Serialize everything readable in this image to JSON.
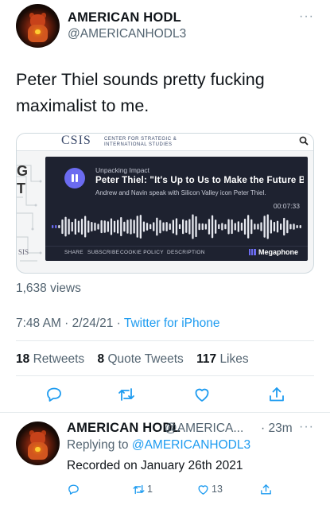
{
  "tweet": {
    "author_name": "AMERICAN HODL",
    "author_handle": "@AMERICANHODL3",
    "more_label": "···",
    "text": "Peter Thiel sounds pretty fucking maximalist to me.",
    "card": {
      "site_logo": "CSIS",
      "site_subtitle_1": "CENTER FOR STRATEGIC &",
      "site_subtitle_2": "INTERNATIONAL STUDIES",
      "side_letters": "G\nT",
      "side_footer": "SIS",
      "player": {
        "show": "Unpacking Impact",
        "title": "Peter Thiel: \"It's Up to Us to Make the Future B...",
        "description": "Andrew and Navin speak with Silicon Valley icon Peter Thiel.",
        "time": "00:07:33",
        "footer_links": [
          "SHARE",
          "SUBSCRIBE",
          "COOKIE POLICY",
          "DESCRIPTION"
        ],
        "brand": "Megaphone",
        "accent_color": "#6b6bf0"
      }
    },
    "views": "1,638 views",
    "time": "7:48 AM",
    "date": "2/24/21",
    "dot": " · ",
    "app": "Twitter for iPhone",
    "stats": {
      "retweets_count": "18",
      "retweets_label": "Retweets",
      "quotes_count": "8",
      "quotes_label": "Quote Tweets",
      "likes_count": "117",
      "likes_label": "Likes"
    },
    "actions": [
      "reply-icon",
      "retweet-icon",
      "like-icon",
      "share-icon"
    ]
  },
  "reply": {
    "author_name": "AMERICAN HODL",
    "author_handle": "@AMERICA...",
    "age": "· 23m",
    "more_label": "···",
    "replying_prefix": "Replying to ",
    "replying_to": "@AMERICANHODL3",
    "text": "Recorded on January 26th 2021",
    "retweet_count": "1",
    "like_count": "13"
  },
  "colors": {
    "link_blue": "#1d9bf0",
    "secondary_text": "#536471",
    "player_bg": "#1e2230"
  }
}
